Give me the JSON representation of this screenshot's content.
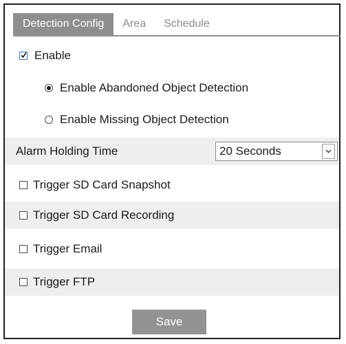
{
  "tabs": [
    {
      "label": "Detection Config",
      "active": true
    },
    {
      "label": "Area",
      "active": false
    },
    {
      "label": "Schedule",
      "active": false
    }
  ],
  "enable": {
    "label": "Enable",
    "checked": true
  },
  "detection_mode": {
    "options": [
      {
        "label": "Enable Abandoned Object Detection",
        "selected": true
      },
      {
        "label": "Enable Missing Object Detection",
        "selected": false
      }
    ]
  },
  "alarm_holding_time": {
    "label": "Alarm Holding Time",
    "value": "20 Seconds"
  },
  "triggers": [
    {
      "label": "Trigger SD Card Snapshot",
      "checked": false
    },
    {
      "label": "Trigger SD Card Recording",
      "checked": false
    },
    {
      "label": "Trigger Email",
      "checked": false
    },
    {
      "label": "Trigger FTP",
      "checked": false
    }
  ],
  "save_label": "Save",
  "colors": {
    "active_tab": "#8e8e8e",
    "row_shade": "#eeeeee",
    "save_button": "#939393",
    "checkbox_checked": "#3a76c4"
  }
}
